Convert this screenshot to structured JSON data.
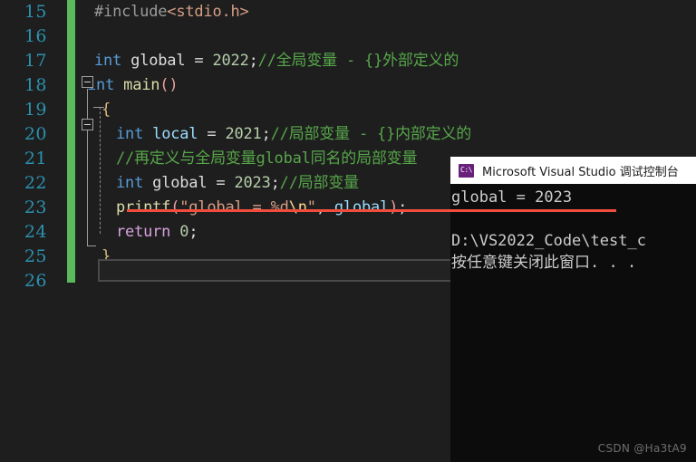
{
  "editor": {
    "background": "#1e1e1e",
    "line_number_color": "#2b91af",
    "change_bar_color": "#5cb85c",
    "lines": [
      {
        "num": "15",
        "segments": [
          {
            "text": "#include",
            "cls": "t-pre"
          },
          {
            "text": "<stdio.h>",
            "cls": "t-inc"
          }
        ]
      },
      {
        "num": "16",
        "segments": []
      },
      {
        "num": "17",
        "segments": [
          {
            "text": "int",
            "cls": "t-kw"
          },
          {
            "text": " ",
            "cls": "t-plain"
          },
          {
            "text": "global",
            "cls": "t-plain"
          },
          {
            "text": " = ",
            "cls": "t-plain"
          },
          {
            "text": "2022",
            "cls": "t-num"
          },
          {
            "text": ";",
            "cls": "t-punct"
          },
          {
            "text": "//全局变量 - {}外部定义的",
            "cls": "t-com"
          }
        ]
      },
      {
        "num": "18",
        "segments": [
          {
            "text": "int",
            "cls": "t-kw"
          },
          {
            "text": " ",
            "cls": "t-plain"
          },
          {
            "text": "main",
            "cls": "t-fn"
          },
          {
            "text": "()",
            "cls": "t-paren"
          }
        ]
      },
      {
        "num": "19",
        "segments": [
          {
            "text": "{",
            "cls": "t-brace"
          }
        ]
      },
      {
        "num": "20",
        "segments": [
          {
            "text": "int",
            "cls": "t-kw"
          },
          {
            "text": " ",
            "cls": "t-plain"
          },
          {
            "text": "local",
            "cls": "t-var"
          },
          {
            "text": " = ",
            "cls": "t-plain"
          },
          {
            "text": "2021",
            "cls": "t-num"
          },
          {
            "text": ";",
            "cls": "t-punct"
          },
          {
            "text": "//局部变量 - {}内部定义的",
            "cls": "t-com"
          }
        ]
      },
      {
        "num": "21",
        "segments": [
          {
            "text": "//再定义与全局变量global同名的局部变量",
            "cls": "t-com"
          }
        ]
      },
      {
        "num": "22",
        "segments": [
          {
            "text": "int",
            "cls": "t-kw"
          },
          {
            "text": " ",
            "cls": "t-plain"
          },
          {
            "text": "global",
            "cls": "t-plain"
          },
          {
            "text": " = ",
            "cls": "t-plain"
          },
          {
            "text": "2023",
            "cls": "t-num"
          },
          {
            "text": ";",
            "cls": "t-punct"
          },
          {
            "text": "//局部变量",
            "cls": "t-com"
          }
        ]
      },
      {
        "num": "23",
        "segments": [
          {
            "text": "printf",
            "cls": "t-fn"
          },
          {
            "text": "(",
            "cls": "t-paren"
          },
          {
            "text": "\"global = %d",
            "cls": "t-str"
          },
          {
            "text": "\\n",
            "cls": "t-esc"
          },
          {
            "text": "\"",
            "cls": "t-str"
          },
          {
            "text": ", ",
            "cls": "t-punct"
          },
          {
            "text": "global",
            "cls": "t-var"
          },
          {
            "text": ")",
            "cls": "t-paren"
          },
          {
            "text": ";",
            "cls": "t-punct"
          }
        ]
      },
      {
        "num": "24",
        "segments": [
          {
            "text": "return",
            "cls": "t-ret"
          },
          {
            "text": " ",
            "cls": "t-plain"
          },
          {
            "text": "0",
            "cls": "t-num"
          },
          {
            "text": ";",
            "cls": "t-punct"
          }
        ]
      },
      {
        "num": "25",
        "segments": [
          {
            "text": "}",
            "cls": "t-brace"
          }
        ]
      },
      {
        "num": "26",
        "segments": []
      }
    ],
    "annotation_color": "#f14c3c"
  },
  "console": {
    "title": "Microsoft Visual Studio 调试控制台",
    "icon_label": "C:\\",
    "background": "#0c0c0c",
    "text_color": "#cccccc",
    "lines": [
      "global = 2023",
      "",
      "D:\\VS2022_Code\\test_c",
      "按任意键关闭此窗口. . ."
    ]
  },
  "watermark": {
    "text": "CSDN @Ha3tA9"
  }
}
